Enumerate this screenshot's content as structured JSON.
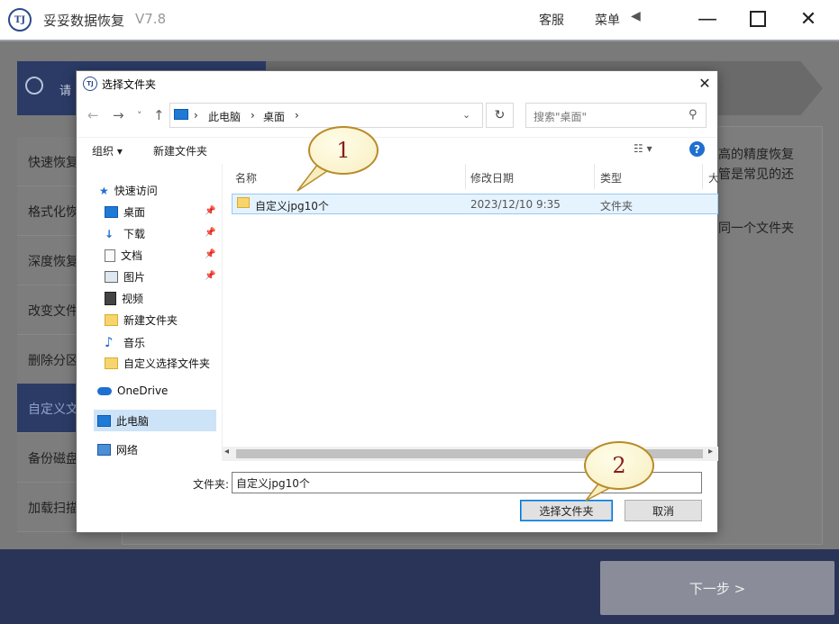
{
  "app": {
    "logo_text": "TJ",
    "title": "妥妥数据恢复",
    "version": "V7.8",
    "service": "客服",
    "menu": "菜单",
    "menu_arrow": "◀",
    "minimize": "—",
    "close": "✕"
  },
  "search": {
    "hint": "请"
  },
  "sidebar": {
    "items": [
      {
        "label": "快速恢复"
      },
      {
        "label": "格式化恢复"
      },
      {
        "label": "深度恢复"
      },
      {
        "label": "改变文件"
      },
      {
        "label": "删除分区"
      },
      {
        "label": "自定义文件"
      },
      {
        "label": "备份磁盘"
      },
      {
        "label": "加载扫描"
      }
    ]
  },
  "right_panel": {
    "line1": "高的精度恢复",
    "line2": "管是常见的还",
    "line3": "同一个文件夹"
  },
  "next_button": "下一步 >",
  "dialog": {
    "title": "选择文件夹",
    "close": "✕",
    "nav": {
      "back": "←",
      "forward": "→",
      "recent": "˅",
      "up": "↑"
    },
    "breadcrumb": [
      "此电脑",
      "桌面"
    ],
    "sep": "›",
    "address_dropdown": "⌄",
    "refresh": "↻",
    "search_placeholder": "搜索\"桌面\"",
    "search_icon": "⚲",
    "toolbar": {
      "organize": "组织 ▾",
      "new_folder": "新建文件夹",
      "view": "☷ ▾",
      "help": "?"
    },
    "tree": {
      "quick_access": "快速访问",
      "desktop": "桌面",
      "downloads": "下载",
      "documents": "文档",
      "pictures": "图片",
      "videos": "视频",
      "new_folder": "新建文件夹",
      "music": "音乐",
      "custom_folder": "自定义选择文件夹",
      "onedrive": "OneDrive",
      "this_pc": "此电脑",
      "network": "网络"
    },
    "pin": "📌",
    "columns": {
      "name": "名称",
      "modified": "修改日期",
      "type": "类型",
      "size": "大"
    },
    "files": [
      {
        "name": "自定义jpg10个",
        "modified": "2023/12/10 9:35",
        "type": "文件夹"
      }
    ],
    "scroll_left": "◂",
    "scroll_right": "▸",
    "folder_label": "文件夹:",
    "folder_value": "自定义jpg10个",
    "select_button": "选择文件夹",
    "cancel_button": "取消"
  },
  "callouts": [
    "1",
    "2"
  ],
  "colors": {
    "accent_navy": "#2b3b66",
    "selection_blue": "#cde3f7",
    "callout_border": "#b98b2a"
  }
}
